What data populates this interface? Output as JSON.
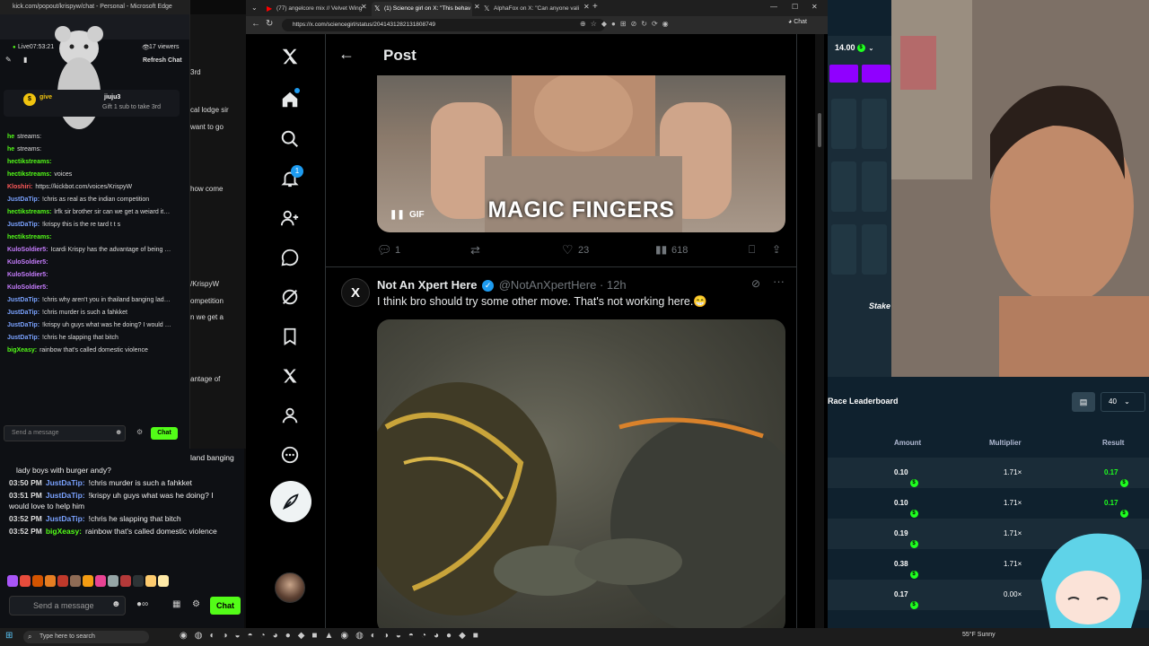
{
  "kick_popout": {
    "window_title": "kick.com/popout/krispyw/chat - Personal - Microsoft Edge",
    "live_time": "Live07:53:21",
    "viewers": "17 viewers",
    "refresh_label": "Refresh Chat",
    "pinned_gift_user": "jiuju3",
    "pinned_gift_text": "Gift 1 sub to take 3rd",
    "pinned_left_user": "give",
    "messages": [
      {
        "user": "he",
        "text": "streams:",
        "color": "#53fc18"
      },
      {
        "user": "he",
        "text": "streams:",
        "color": "#53fc18"
      },
      {
        "user": "hectikstreams:",
        "text": "",
        "color": "#53fc18"
      },
      {
        "user": "hectikstreams:",
        "text": "voices",
        "color": "#53fc18"
      },
      {
        "user": "Kloshiri:",
        "text": "https://kickbot.com/voices/KrispyW",
        "color": "#ff5a5a"
      },
      {
        "user": "JustDaTip:",
        "text": "!chris as real as the indian competition",
        "color": "#7aa2ff"
      },
      {
        "user": "hectikstreams:",
        "text": "lrfk sir brother sir can we get a weiard its sir",
        "color": "#53fc18"
      },
      {
        "user": "JustDaTip:",
        "text": "!krispy this is the re tard t t s",
        "color": "#7aa2ff"
      },
      {
        "user": "hectikstreams:",
        "text": "",
        "color": "#53fc18"
      },
      {
        "user": "KuloSoldier5:",
        "text": "Icardi Krispy has the advantage of being forever a teenager",
        "color": "#c77dff"
      },
      {
        "user": "KuloSoldier5:",
        "text": "",
        "color": "#c77dff"
      },
      {
        "user": "KuloSoldier5:",
        "text": "",
        "color": "#c77dff"
      },
      {
        "user": "KuloSoldier5:",
        "text": "",
        "color": "#c77dff"
      },
      {
        "user": "JustDaTip:",
        "text": "!chris why aren't you in thailand banging lady boys with burger andy?",
        "color": "#7aa2ff"
      },
      {
        "user": "JustDaTip:",
        "text": "!chris murder is such a fahkket",
        "color": "#7aa2ff"
      },
      {
        "user": "JustDaTip:",
        "text": "!krispy uh guys what was he doing? I would love to help him",
        "color": "#7aa2ff"
      },
      {
        "user": "JustDaTip:",
        "text": "!chris he slapping that bitch",
        "color": "#7aa2ff"
      },
      {
        "user": "bigXeasy:",
        "text": "rainbow that's called domestic violence",
        "color": "#53fc18"
      }
    ],
    "input_placeholder": "Send a message",
    "chat_button": "Chat"
  },
  "mid_strip": {
    "lines": [
      "3rd",
      "cal lodge sir",
      "want to go",
      "how come",
      "/KrispyW",
      "ompetition",
      "n we get a",
      "antage of",
      "land banging"
    ]
  },
  "stream_chat": {
    "rows": [
      {
        "time": "",
        "user": "",
        "text": "lady boys with burger andy?",
        "color": "#7aa2ff"
      },
      {
        "time": "03:50 PM",
        "user": "JustDaTip:",
        "text": "!chris murder is such a fahkket",
        "color": "#7aa2ff"
      },
      {
        "time": "03:51 PM",
        "user": "JustDaTip:",
        "text": "!krispy uh guys what was he doing? I would love to help him",
        "color": "#7aa2ff"
      },
      {
        "time": "03:52 PM",
        "user": "JustDaTip:",
        "text": "!chris he slapping that bitch",
        "color": "#7aa2ff"
      },
      {
        "time": "03:52 PM",
        "user": "bigXeasy:",
        "text": "rainbow that's called domestic violence",
        "color": "#53fc18"
      }
    ],
    "input_placeholder": "Send a message",
    "chat_button": "Chat"
  },
  "browser": {
    "tabs": [
      "(77) angelcore mix // Velvet Wing",
      "(1) Science girl on X: \"This behav",
      "AlphaFox on X: \"Can anyone vali"
    ],
    "url": "https://x.com/sciencegirl/status/2041431282131808749",
    "copilot_label": "Chat"
  },
  "x_post": {
    "header_title": "Post",
    "notification_count": "1",
    "gif_caption": "MAGIC FINGERS",
    "gif_badge": "GIF",
    "stats": {
      "replies": "1",
      "likes": "23",
      "views": "618"
    },
    "reply": {
      "author_name": "Not An Xpert Here",
      "author_handle": "@NotAnXpertHere",
      "time": "· 12h",
      "text": "I think bro should try some other move. That's not working here.😁"
    }
  },
  "stake": {
    "balance": "14.00",
    "leaderboard_title": "Race Leaderboard",
    "page_size": "40",
    "columns": [
      "Amount",
      "Multiplier",
      "Result"
    ],
    "rows": [
      {
        "amount": "0.10",
        "multiplier": "1.71×",
        "result": "0.17"
      },
      {
        "amount": "0.10",
        "multiplier": "1.71×",
        "result": "0.17"
      },
      {
        "amount": "0.19",
        "multiplier": "1.71×",
        "result": ""
      },
      {
        "amount": "0.38",
        "multiplier": "1.71×",
        "result": ""
      },
      {
        "amount": "0.17",
        "multiplier": "0.00×",
        "result": ""
      }
    ],
    "stake_watermark": "Stake"
  },
  "taskbar": {
    "search_placeholder": "Type here to search",
    "weather": "55°F Sunny"
  }
}
